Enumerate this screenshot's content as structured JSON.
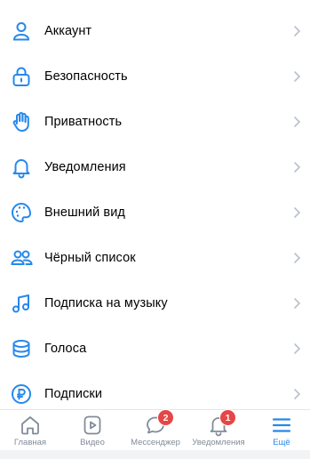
{
  "colors": {
    "accent": "#2688eb",
    "chevron": "#b8c1cc",
    "tab_inactive": "#818c99",
    "badge": "#e64646"
  },
  "menu": {
    "items": [
      {
        "label": "Аккаунт",
        "icon": "user-icon"
      },
      {
        "label": "Безопасность",
        "icon": "lock-icon"
      },
      {
        "label": "Приватность",
        "icon": "hand-icon"
      },
      {
        "label": "Уведомления",
        "icon": "bell-icon"
      },
      {
        "label": "Внешний вид",
        "icon": "palette-icon"
      },
      {
        "label": "Чёрный список",
        "icon": "users-icon"
      },
      {
        "label": "Подписка на музыку",
        "icon": "music-note-icon"
      },
      {
        "label": "Голоса",
        "icon": "coins-stack-icon"
      },
      {
        "label": "Подписки",
        "icon": "ruble-icon"
      }
    ]
  },
  "tabbar": {
    "tabs": [
      {
        "label": "Главная",
        "icon": "home-icon",
        "active": false
      },
      {
        "label": "Видео",
        "icon": "video-icon",
        "active": false
      },
      {
        "label": "Мессенджер",
        "icon": "chat-icon",
        "active": false,
        "badge": "2"
      },
      {
        "label": "Уведомления",
        "icon": "bell-icon",
        "active": false,
        "badge": "1"
      },
      {
        "label": "Ещё",
        "icon": "menu-icon",
        "active": true
      }
    ]
  }
}
